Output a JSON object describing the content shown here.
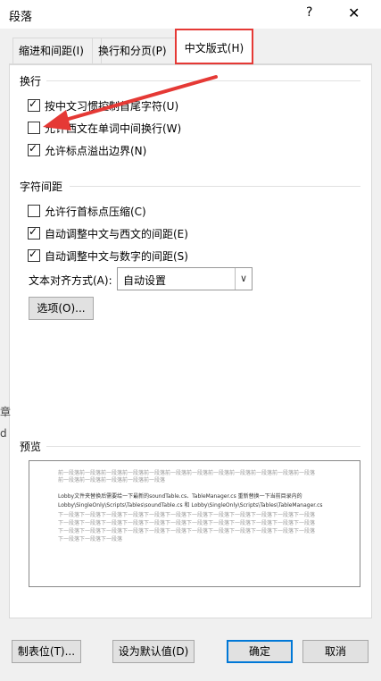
{
  "window": {
    "title": "段落",
    "help": "?",
    "close": "✕"
  },
  "tabs": [
    {
      "label": "缩进和间距(I)"
    },
    {
      "label": "换行和分页(P)"
    },
    {
      "label": "中文版式(H)"
    }
  ],
  "line_break": {
    "heading": "换行",
    "options": [
      {
        "label": "按中文习惯控制首尾字符(U)",
        "checked": true
      },
      {
        "label": "允许西文在单词中间换行(W)",
        "checked": false
      },
      {
        "label": "允许标点溢出边界(N)",
        "checked": true
      }
    ]
  },
  "char_spacing": {
    "heading": "字符间距",
    "options": [
      {
        "label": "允许行首标点压缩(C)",
        "checked": false
      },
      {
        "label": "自动调整中文与西文的间距(E)",
        "checked": true
      },
      {
        "label": "自动调整中文与数字的间距(S)",
        "checked": true
      }
    ],
    "align_label": "文本对齐方式(A):",
    "align_value": "自动设置",
    "options_button": "选项(O)..."
  },
  "preview": {
    "heading": "预览",
    "lines": [
      "前一段落前一段落前一段落前一段落前一段落前一段落前一段落前一段落前一段落前一段落前一段落前一段落",
      "前一段落前一段落前一段落前一段落前一段落",
      "Lobby文件夹替换后需要给一下最新的soundTable.cs、TableManager.cs 重新替换一下当前目录内的",
      "Lobby\\SingleOnly\\Scripts\\Tables\\soundTable.cs 和 Lobby\\SingleOnly\\Scripts\\Tables\\TableManager.cs",
      "下一段落下一段落下一段落下一段落下一段落下一段落下一段落下一段落下一段落下一段落下一段落下一段落",
      "下一段落下一段落下一段落下一段落下一段落下一段落下一段落下一段落下一段落下一段落下一段落下一段落",
      "下一段落下一段落下一段落下一段落下一段落下一段落下一段落下一段落下一段落下一段落下一段落下一段落",
      "下一段落下一段落下一段落"
    ]
  },
  "footer": {
    "tabs_button": "制表位(T)...",
    "default_button": "设为默认值(D)",
    "ok": "确定",
    "cancel": "取消"
  },
  "background_fragments": [
    "章",
    "d"
  ],
  "annotation_color": "#e53935"
}
